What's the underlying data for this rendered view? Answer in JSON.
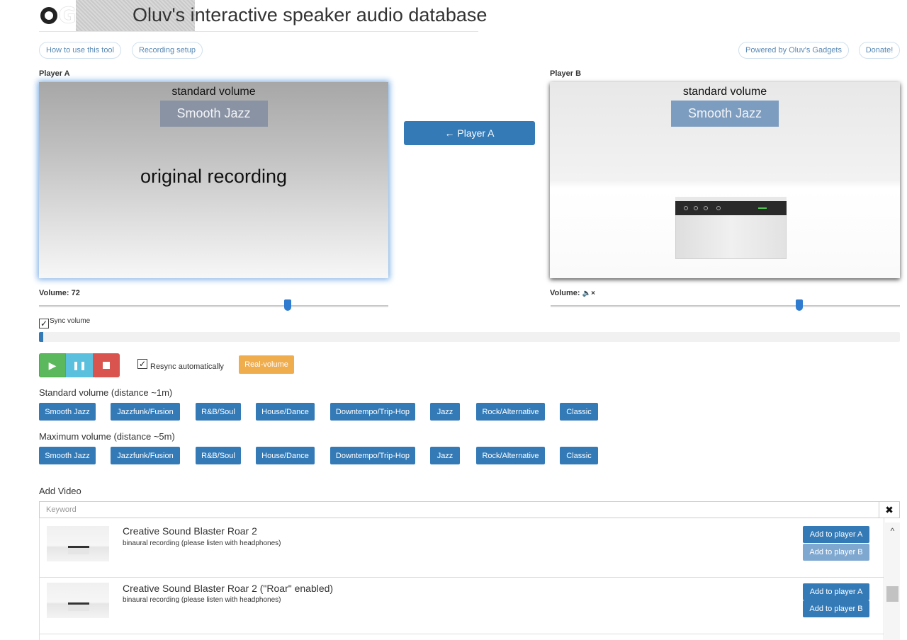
{
  "header": {
    "logo_text": "OG",
    "title": "Oluv's interactive speaker audio database"
  },
  "nav": {
    "how_to": "How to use this tool",
    "recording_setup": "Recording setup",
    "powered_by": "Powered by Oluv's Gadgets",
    "donate": "Donate!"
  },
  "player_a": {
    "label": "Player A",
    "volume_mode": "standard volume",
    "genre": "Smooth Jazz",
    "caption": "original recording",
    "volume_label": "Volume: 72",
    "volume_value": 72
  },
  "player_b": {
    "label": "Player B",
    "volume_mode": "standard volume",
    "genre": "Smooth Jazz",
    "volume_label": "Volume:",
    "volume_icon": "speaker-muted-icon",
    "volume_fraction": 0.71
  },
  "swap_button": "← Player A",
  "sync_volume": {
    "label": "Sync volume",
    "checked": true
  },
  "playback": {
    "progress_fraction": 0.005,
    "play_icon": "play-icon",
    "pause_icon": "pause-icon",
    "stop_icon": "stop-icon",
    "colors": {
      "play": "#5cb85c",
      "pause": "#5bc0de",
      "stop": "#d9534f"
    }
  },
  "resync": {
    "label": "Resync automatically",
    "checked": true
  },
  "real_volume": "Real-volume",
  "standard_section": {
    "heading": "Standard volume (distance ~1m)",
    "genres": [
      "Smooth Jazz",
      "Jazzfunk/Fusion",
      "R&B/Soul",
      "House/Dance",
      "Downtempo/Trip-Hop",
      "Jazz",
      "Rock/Alternative",
      "Classic"
    ]
  },
  "maximum_section": {
    "heading": "Maximum volume (distance ~5m)",
    "genres": [
      "Smooth Jazz",
      "Jazzfunk/Fusion",
      "R&B/Soul",
      "House/Dance",
      "Downtempo/Trip-Hop",
      "Jazz",
      "Rock/Alternative",
      "Classic"
    ]
  },
  "add_video": {
    "heading": "Add Video",
    "placeholder": "Keyword",
    "clear_icon": "close-icon"
  },
  "results": [
    {
      "title": "Creative Sound Blaster Roar 2",
      "subtitle": "binaural recording (please listen with headphones)",
      "add_a": "Add to player A",
      "add_b": "Add to player B"
    },
    {
      "title": "Creative Sound Blaster Roar 2 (\"Roar\" enabled)",
      "subtitle": "binaural recording (please listen with headphones)",
      "add_a": "Add to player A",
      "add_b": "Add to player B"
    }
  ],
  "colors": {
    "primary": "#337ab7",
    "warning": "#f0ad4e",
    "player_a_glow": "#7fb1e6"
  }
}
